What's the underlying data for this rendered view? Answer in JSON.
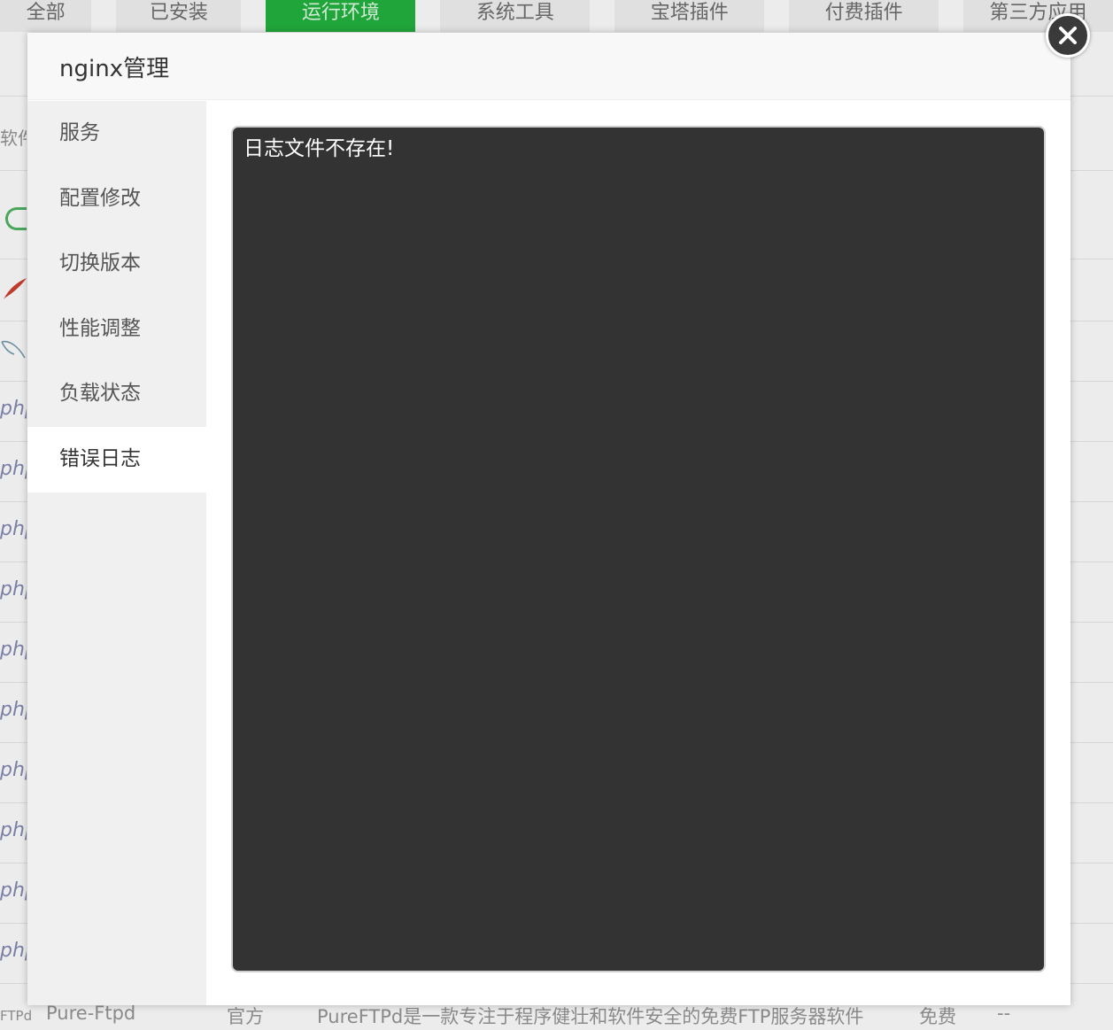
{
  "background": {
    "tabs": [
      {
        "label": "全部",
        "active": false
      },
      {
        "label": "已安装",
        "active": false
      },
      {
        "label": "运行环境",
        "active": true
      },
      {
        "label": "系统工具",
        "active": false
      },
      {
        "label": "宝塔插件",
        "active": false
      },
      {
        "label": "付费插件",
        "active": false
      },
      {
        "label": "第三方应用",
        "active": false
      }
    ],
    "left_column_header": "软件",
    "left_row_labels": [
      "php",
      "php",
      "php",
      "php",
      "php",
      "php",
      "php",
      "php",
      "php",
      "php"
    ],
    "footer_row": {
      "icon_text": "FTPd",
      "name": "Pure-Ftpd",
      "developer": "官方",
      "description": "PureFTPd是一款专注于程序健壮和软件安全的免费FTP服务器软件",
      "price": "免费",
      "expiry": "--"
    },
    "accent_color": "#20a53a"
  },
  "modal": {
    "title": "nginx管理",
    "close_icon": "close-icon",
    "sidebar_items": [
      {
        "label": "服务",
        "active": false
      },
      {
        "label": "配置修改",
        "active": false
      },
      {
        "label": "切换版本",
        "active": false
      },
      {
        "label": "性能调整",
        "active": false
      },
      {
        "label": "负载状态",
        "active": false
      },
      {
        "label": "错误日志",
        "active": true
      }
    ],
    "log_text": "日志文件不存在!"
  }
}
